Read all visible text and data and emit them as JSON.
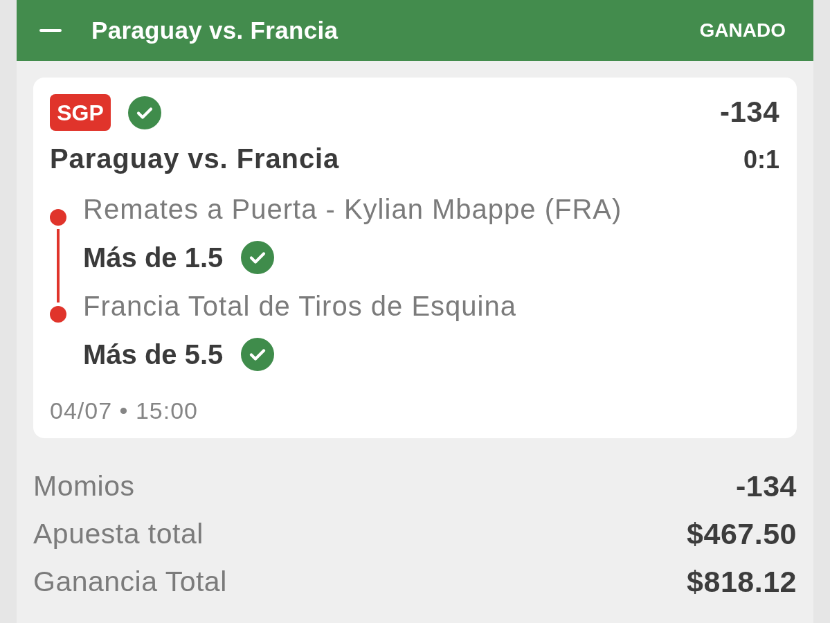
{
  "header": {
    "expanded": true,
    "title": "Paraguay vs. Francia",
    "status": "GANADO"
  },
  "bet": {
    "tag": "SGP",
    "won": true,
    "odds": "-134",
    "event": "Paraguay vs. Francia",
    "score": "0:1",
    "legs": [
      {
        "market": "Remates a Puerta - Kylian Mbappe (FRA)",
        "selection": "Más de 1.5",
        "won": true
      },
      {
        "market": "Francia Total de Tiros de Esquina",
        "selection": "Más de 5.5",
        "won": true
      }
    ],
    "datetime": "04/07 • 15:00"
  },
  "summary": [
    {
      "label": "Momios",
      "value": "-134"
    },
    {
      "label": "Apuesta total",
      "value": "$467.50"
    },
    {
      "label": "Ganancia Total",
      "value": "$818.12"
    }
  ]
}
